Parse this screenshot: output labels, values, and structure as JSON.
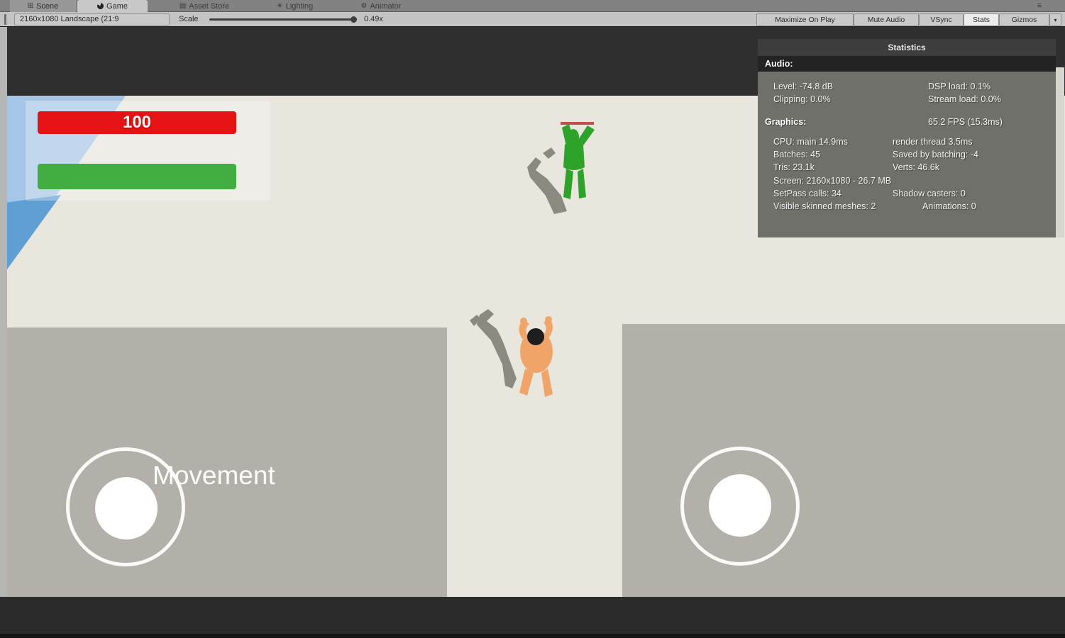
{
  "window": {
    "tabs": [
      {
        "label": "Scene"
      },
      {
        "label": "Game"
      },
      {
        "label": "Asset Store"
      },
      {
        "label": "Lighting"
      },
      {
        "label": "Animator"
      }
    ]
  },
  "icons": {
    "scene": "⊞",
    "asset_store": "▤",
    "lighting": "☀",
    "animator": "⚙",
    "window_menu": "≡",
    "gizmos_arrow": "▾"
  },
  "toolbar": {
    "aspect_dropdown": "2160x1080 Landscape (21:9",
    "scale_label": "Scale",
    "scale_value": "0.49x",
    "maximize_on_play": "Maximize On Play",
    "mute_audio": "Mute Audio",
    "vsync": "VSync",
    "stats": "Stats",
    "gizmos": "Gizmos"
  },
  "statistics": {
    "title": "Statistics",
    "audio_header": "Audio:",
    "audio_rows": [
      {
        "left": "Level: -74.8 dB",
        "right": "DSP load: 0.1%"
      },
      {
        "left": "Clipping: 0.0%",
        "right": "Stream load: 0.0%"
      }
    ],
    "graphics_header": "Graphics:",
    "fps": "65.2 FPS (15.3ms)",
    "graphics_rows": [
      {
        "left": "CPU: main 14.9ms",
        "right": "render thread 3.5ms"
      },
      {
        "left": "Batches: 45",
        "right": "Saved by batching: -4"
      },
      {
        "left": "Tris: 23.1k",
        "right": "Verts: 46.6k"
      },
      {
        "left": "Screen: 2160x1080 - 26.7 MB",
        "right": ""
      },
      {
        "left": "SetPass calls: 34",
        "right": "Shadow casters: 0"
      },
      {
        "left": "Visible skinned meshes: 2",
        "right": "Animations: 0"
      }
    ]
  },
  "hud": {
    "enemy_health": "100",
    "movement_label": "Movement"
  },
  "colors": {
    "health_red": "#e51313",
    "health_green": "#42ae41",
    "water_light": "#a5c6e6",
    "water_dark": "#5f9fd4",
    "ground": "#e8e6dd",
    "platform": "#b2b0a9",
    "enemy_green": "#2ea32a",
    "player_skin": "#f1a468",
    "enemy_health_line": "#c0504d"
  }
}
